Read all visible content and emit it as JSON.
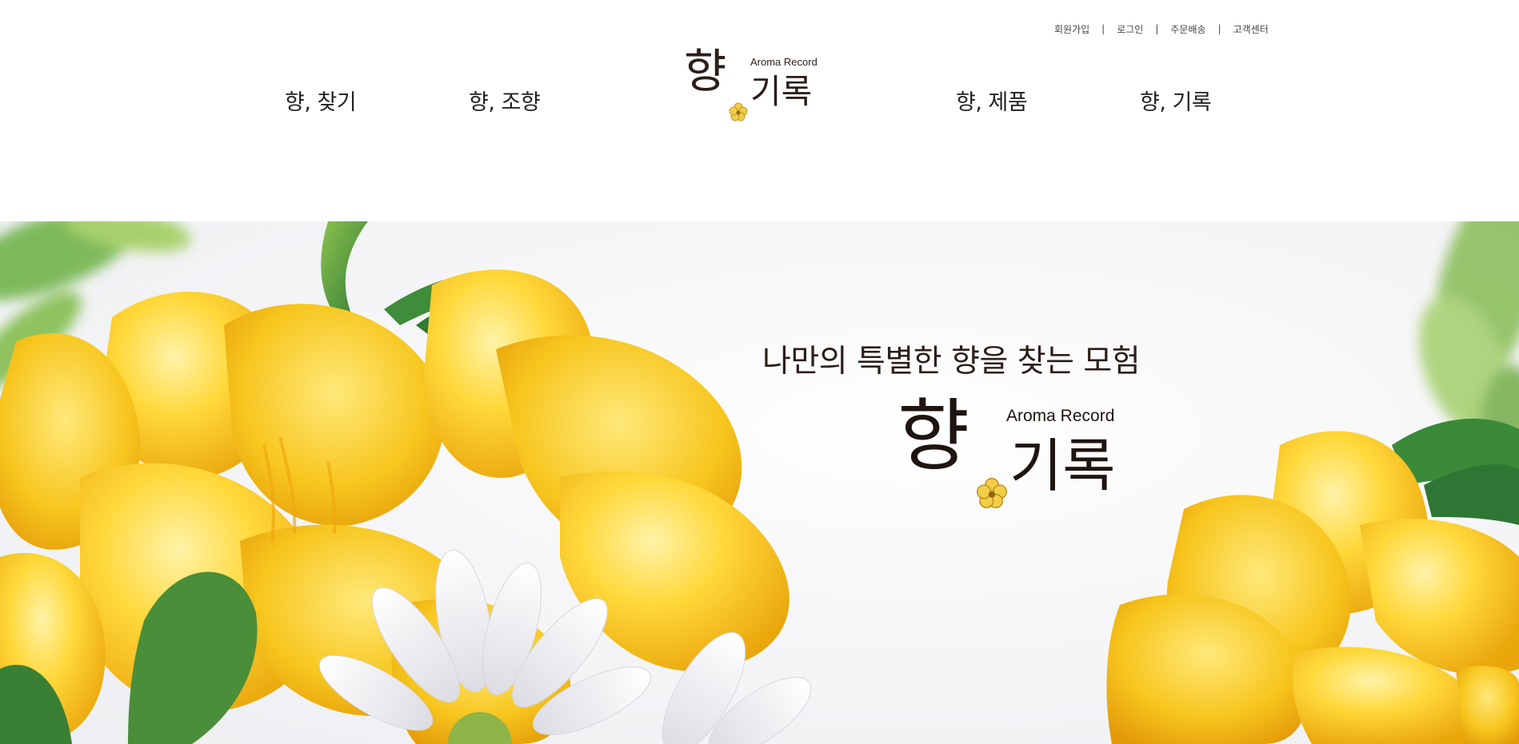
{
  "utility_nav": {
    "signup": "회원가입",
    "login": "로그인",
    "order_delivery": "주문배송",
    "customer_center": "고객센터",
    "separator": "|"
  },
  "main_nav": {
    "find": "향, 찾기",
    "blend": "향, 조향",
    "products": "향, 제품",
    "record": "향, 기록"
  },
  "logo": {
    "hyang": "향",
    "record_ko": "기록",
    "record_en": "Aroma Record"
  },
  "hero": {
    "tagline": "나만의 특별한 향을 찾는 모험",
    "logo_hyang": "향",
    "logo_record_ko": "기록",
    "logo_record_en": "Aroma Record"
  },
  "colors": {
    "text": "#222222",
    "logo_text": "#2b1f1a",
    "flower_yellow": "#f5c518",
    "leaf_green": "#3d8a3a"
  }
}
